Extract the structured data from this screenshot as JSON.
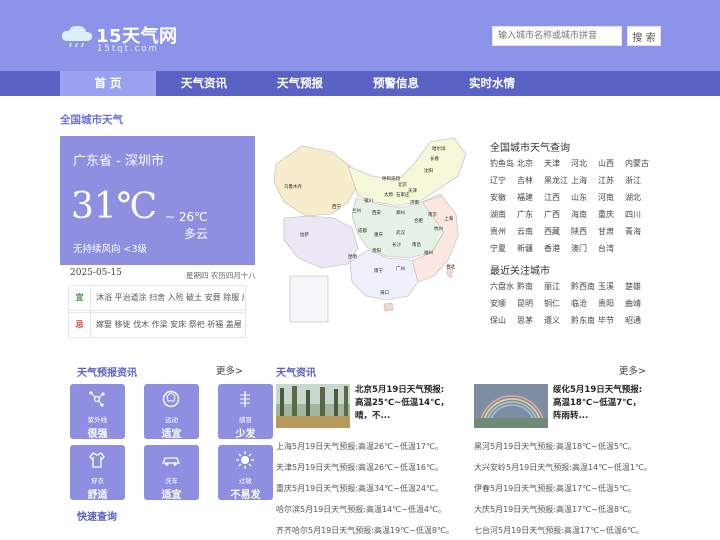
{
  "header": {
    "logo_title": "15天气网",
    "logo_sub": "15tqt.com",
    "search_placeholder": "输入城市名称或城市拼音",
    "search_button": "搜 索"
  },
  "nav": [
    "首 页",
    "天气资讯",
    "天气预报",
    "预警信息",
    "实时水情"
  ],
  "section_title": "全国城市天气",
  "current": {
    "city": "广东省 - 深圳市",
    "temp": "31℃",
    "low": "~ 26℃",
    "condition": "多云",
    "wind": "无持续风向  <3级",
    "date": "2025-05-15",
    "lunar": "星期四 农历四月十八"
  },
  "almanac": [
    {
      "tag": "宜",
      "text": "沐浴 平治道涂 扫舍 入殓 破土 安葬 除服 成服"
    },
    {
      "tag": "忌",
      "text": "嫁娶 移徙 伐木 作梁 安床 祭祀 祈福 盖屋"
    }
  ],
  "map_labels": [
    "乌鲁木齐",
    "哈尔滨",
    "长春",
    "沈阳",
    "呼和浩特",
    "北京",
    "天津",
    "石家庄",
    "太原",
    "济南",
    "银川",
    "西宁",
    "兰州",
    "西安",
    "郑州",
    "拉萨",
    "成都",
    "重庆",
    "武汉",
    "合肥",
    "南京",
    "上海",
    "杭州",
    "长沙",
    "南昌",
    "福州",
    "贵阳",
    "昆明",
    "南宁",
    "广州",
    "台北",
    "海口"
  ],
  "city_query": {
    "title": "全国城市天气查询",
    "cities": [
      "钓鱼岛",
      "北京",
      "天津",
      "河北",
      "山西",
      "内蒙古",
      "辽宁",
      "吉林",
      "黑龙江",
      "上海",
      "江苏",
      "浙江",
      "安徽",
      "福建",
      "江西",
      "山东",
      "河南",
      "湖北",
      "湖南",
      "广东",
      "广西",
      "海南",
      "重庆",
      "四川",
      "贵州",
      "云南",
      "西藏",
      "陕西",
      "甘肃",
      "青海",
      "宁夏",
      "新疆",
      "香港",
      "澳门",
      "台湾"
    ]
  },
  "hot_cities": {
    "title": "最近关注城市",
    "cities": [
      "六盘水",
      "黔南",
      "丽江",
      "黔西南",
      "玉溪",
      "楚雄",
      "安顺",
      "昆明",
      "铜仁",
      "临沧",
      "贵阳",
      "曲靖",
      "保山",
      "思茅",
      "遵义",
      "黔东南",
      "毕节",
      "昭通"
    ]
  },
  "forecast": {
    "title": "天气预报资讯",
    "more": "更多>",
    "tiles": [
      {
        "icon": "uv-icon",
        "label": "紫外线",
        "value": "很强"
      },
      {
        "icon": "sport-icon",
        "label": "运动",
        "value": "适宜"
      },
      {
        "icon": "allergy-icon",
        "label": "感冒",
        "value": "少发"
      },
      {
        "icon": "clothing-icon",
        "label": "穿衣",
        "value": "舒适"
      },
      {
        "icon": "carwash-icon",
        "label": "洗车",
        "value": "适宜"
      },
      {
        "icon": "sun-icon",
        "label": "过敏",
        "value": "不易发"
      }
    ],
    "quick": "快速查询"
  },
  "news": {
    "title": "天气资讯",
    "more": "更多>",
    "featured": [
      {
        "title": "北京5月19日天气预报:高温25℃~低温14℃，晴，不..."
      },
      {
        "title": "绥化5月19日天气预报:高温18℃~低温7℃，阵雨转..."
      }
    ],
    "left": [
      "上海5月19日天气预报:高温26℃~低温17℃。",
      "天津5月19日天气预报:高温26℃~低温16℃。",
      "重庆5月19日天气预报:高温34℃~低温24℃。",
      "哈尔滨5月19日天气预报:高温14℃~低温4℃。",
      "齐齐哈尔5月19日天气预报:高温19℃~低温8℃。"
    ],
    "right": [
      "黑河5月19日天气预报:高温18℃~低温5℃。",
      "大兴安岭5月19日天气预报:高温14℃~低温1℃。",
      "伊春5月19日天气预报:高温17℃~低温5℃。",
      "大庆5月19日天气预报:高温17℃~低温8℃。",
      "七台河5月19日天气预报:高温17℃~低温6℃。"
    ]
  }
}
